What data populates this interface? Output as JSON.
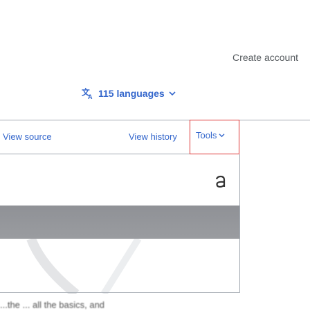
{
  "header": {
    "create_account": "Create account"
  },
  "languages": {
    "label": "115 languages",
    "icon": "translate-icon",
    "chevron": "chevron-down-icon"
  },
  "tabs": {
    "view_source": "View source",
    "view_history": "View history",
    "tools": "Tools"
  },
  "toolbar": {
    "appearance_icon": "font-appearance-icon"
  },
  "content": {
    "partial_text": "...the ... all the basics, and"
  },
  "colors": {
    "link": "#3366cc",
    "highlight_border": "#dd3333",
    "divider": "#a2a9b1"
  }
}
